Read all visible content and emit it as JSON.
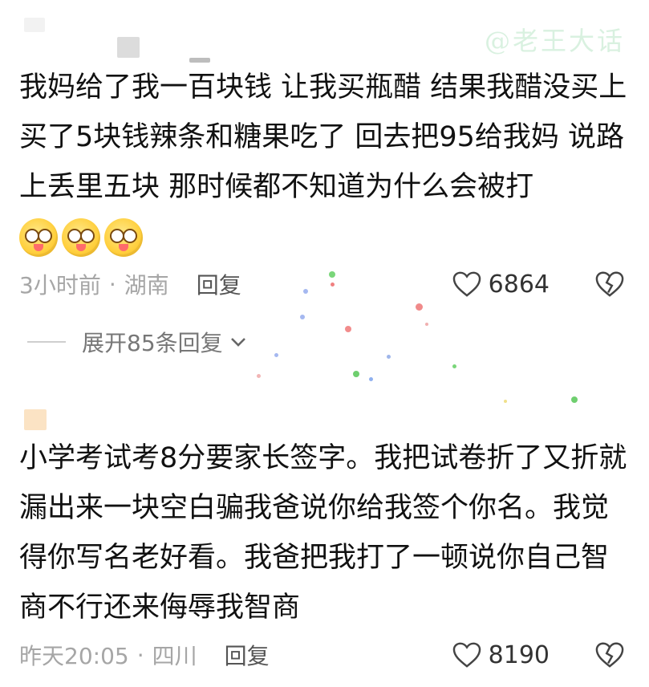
{
  "watermark": "@老王大话",
  "comments": [
    {
      "text": "我妈给了我一百块钱  让我买瓶醋  结果我醋没买上 买了5块钱辣条和糖果吃了 回去把95给我妈 说路上丢里五块 那时候都不知道为什么会被打",
      "emoji_count": 3,
      "time": "3小时前",
      "location": "湖南",
      "reply_label": "回复",
      "likes": "6864",
      "expand_label": "展开85条回复"
    },
    {
      "text": "小学考试考8分要家长签字。我把试卷折了又折就漏出来一块空白骗我爸说你给我签个你名。我觉得你写名老好看。我爸把我打了一顿说你自己智商不行还来侮辱我智商",
      "time": "昨天20:05",
      "location": "四川",
      "reply_label": "回复",
      "likes": "8190"
    }
  ],
  "meta_separator": "·",
  "icons": {
    "like": "heart-outline-icon",
    "dislike": "broken-heart-icon",
    "expand": "chevron-down-icon",
    "emoji": "drooling-face-emoji"
  },
  "colors": {
    "text": "#111111",
    "meta": "#a6a6a6",
    "watermark": "#d9f1e0"
  }
}
